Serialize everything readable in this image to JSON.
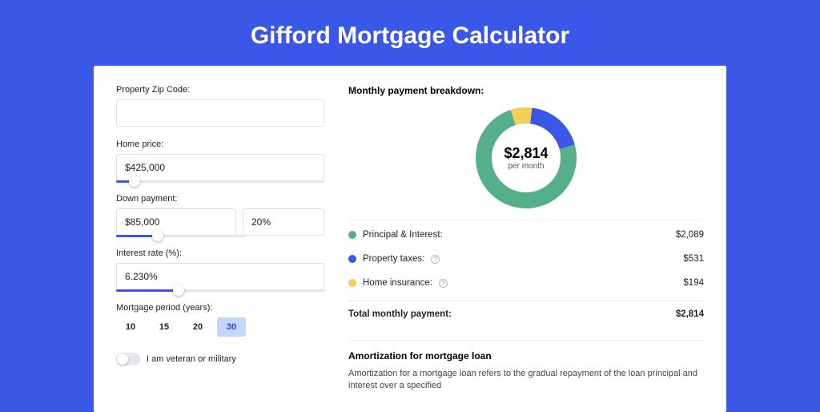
{
  "page": {
    "title": "Gifford Mortgage Calculator"
  },
  "form": {
    "zip": {
      "label": "Property Zip Code:",
      "value": ""
    },
    "home_price": {
      "label": "Home price:",
      "value": "$425,000",
      "slider_position_pct": 9
    },
    "down_payment": {
      "label": "Down payment:",
      "value": "$85,000",
      "pct": "20%",
      "slider_position_pct": 20
    },
    "interest": {
      "label": "Interest rate (%):",
      "value": "6.230%",
      "slider_position_pct": 30
    },
    "period": {
      "label": "Mortgage period (years):",
      "options": [
        "10",
        "15",
        "20",
        "30"
      ],
      "selected": "30"
    },
    "veteran": {
      "label": "I am veteran or military",
      "checked": false
    }
  },
  "breakdown": {
    "title": "Monthly payment breakdown:",
    "donut": {
      "center_value": "$2,814",
      "center_caption": "per month"
    },
    "items": [
      {
        "label": "Principal & Interest:",
        "value": "$2,089",
        "color": "#55b08a",
        "info": false
      },
      {
        "label": "Property taxes:",
        "value": "$531",
        "color": "#3a57e8",
        "info": true
      },
      {
        "label": "Home insurance:",
        "value": "$194",
        "color": "#f0cf5a",
        "info": true
      }
    ],
    "total": {
      "label": "Total monthly payment:",
      "value": "$2,814"
    }
  },
  "amortization": {
    "title": "Amortization for mortgage loan",
    "lead": "Amortization for a mortgage loan refers to the gradual repayment of the loan principal and interest over a specified"
  },
  "chart_data": {
    "type": "pie",
    "title": "Monthly payment breakdown",
    "series": [
      {
        "name": "Principal & Interest",
        "value": 2089,
        "color": "#55b08a"
      },
      {
        "name": "Property taxes",
        "value": 531,
        "color": "#3a57e8"
      },
      {
        "name": "Home insurance",
        "value": 194,
        "color": "#f0cf5a"
      }
    ],
    "total": 2814,
    "unit": "USD/month"
  }
}
